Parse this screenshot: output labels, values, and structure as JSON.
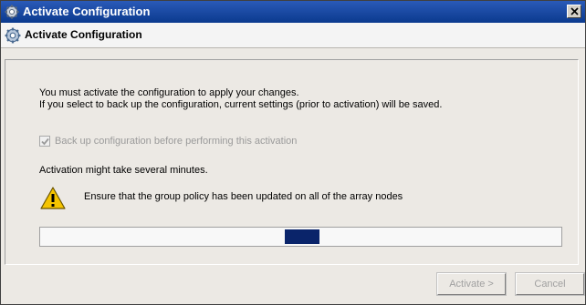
{
  "window": {
    "title": "Activate Configuration",
    "title_icon": "gear-icon",
    "close_icon": "close-icon"
  },
  "header": {
    "title": "Activate Configuration",
    "icon": "gear-icon"
  },
  "content": {
    "message_line1": "You must activate the configuration to apply your changes.",
    "message_line2": "If you select to back up the configuration, current settings (prior to activation) will be saved.",
    "backup_checkbox": {
      "label": "Back up configuration before performing this activation",
      "checked": true,
      "enabled": false
    },
    "activation_note": "Activation might take several minutes.",
    "warning": {
      "icon": "warning-icon",
      "text": "Ensure that the group policy has been updated on all of the array nodes"
    },
    "progress": {
      "indeterminate": true,
      "block_position_fraction": 0.47,
      "color": "#0a246a"
    }
  },
  "buttons": {
    "activate_label": "Activate >",
    "cancel_label": "Cancel"
  },
  "colors": {
    "titlebar": "#0b3a8e",
    "progress_block": "#0a246a",
    "disabled_text": "#9a9a9a"
  }
}
